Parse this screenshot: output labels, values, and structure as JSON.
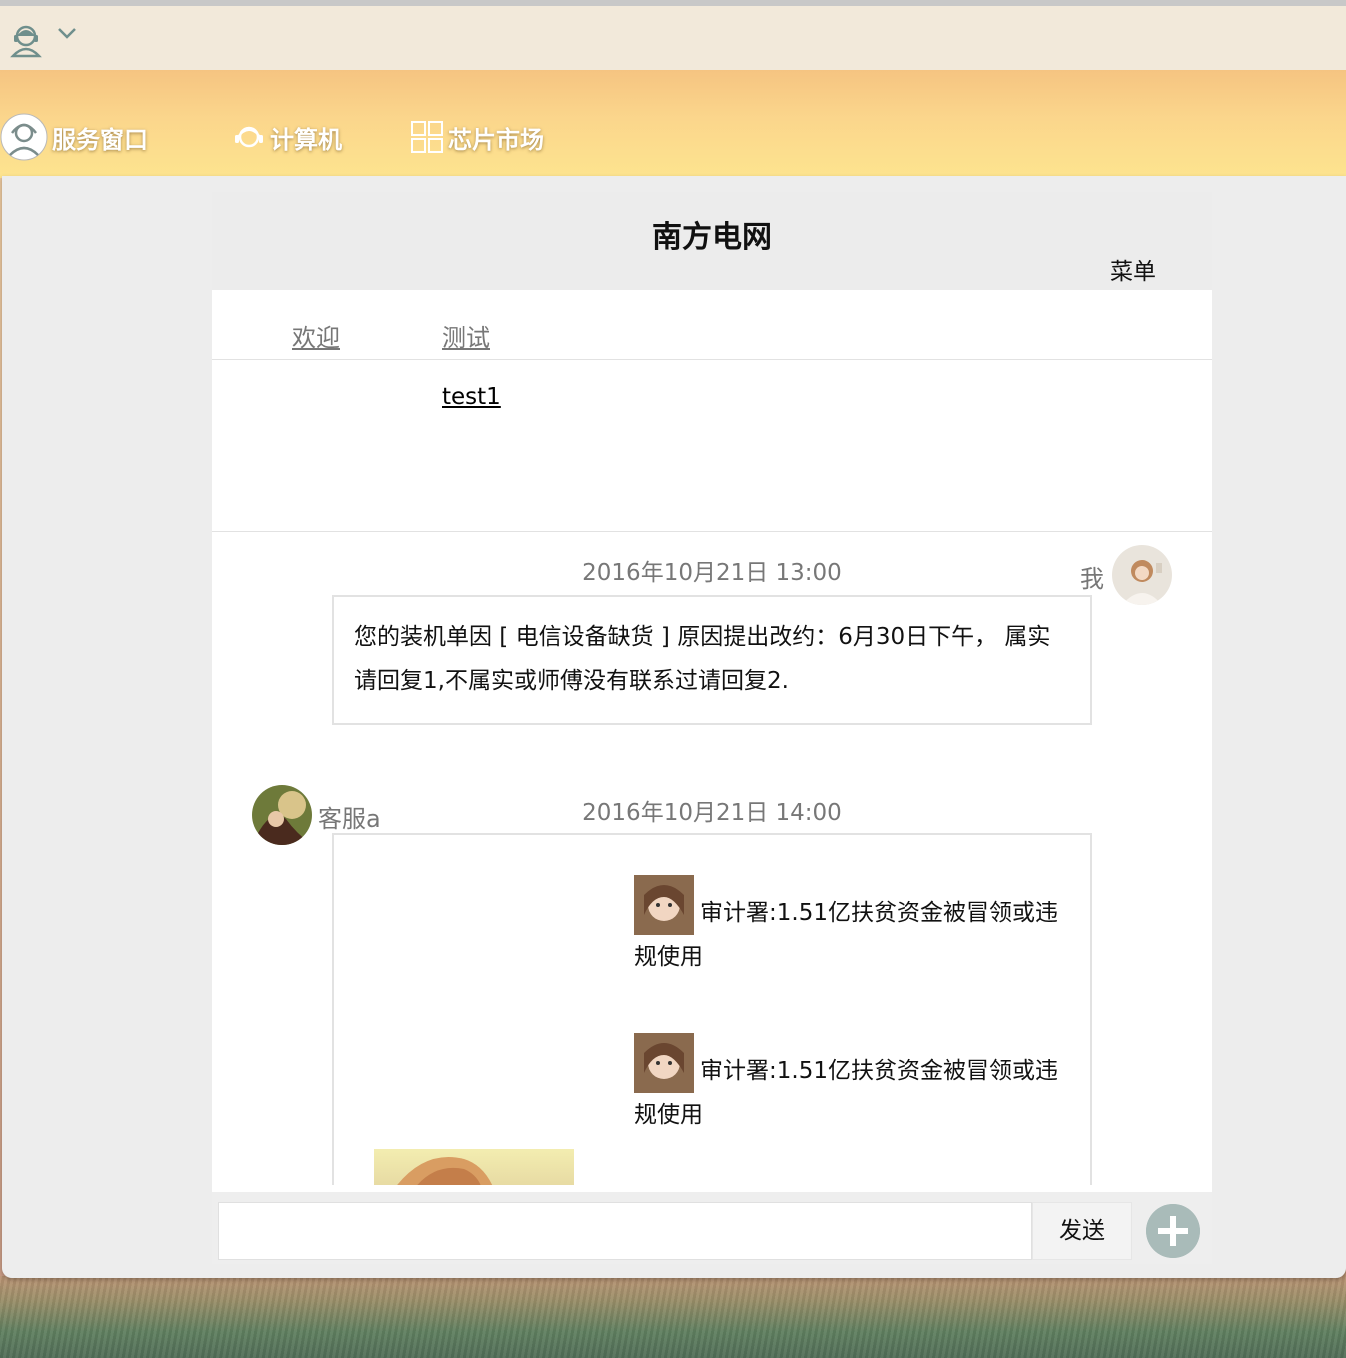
{
  "nav": {
    "items": [
      {
        "label": "服务窗口"
      },
      {
        "label": "计算机"
      },
      {
        "label": "芯片市场"
      }
    ]
  },
  "header": {
    "title": "南方电网",
    "menu_label": "菜单"
  },
  "tabs": [
    {
      "label": "欢迎"
    },
    {
      "label": "测试"
    }
  ],
  "submenu": {
    "item": "test1"
  },
  "chat": {
    "messages": [
      {
        "time": "2016年10月21日 13:00",
        "sender": "我",
        "text": "您的装机单因 [ 电信设备缺货 ] 原因提出改约：6月30日下午， 属实请回复1,不属实或师傅没有联系过请回复2."
      },
      {
        "time": "2016年10月21日 14:00",
        "sender": "客服a",
        "news": [
          {
            "title": "审计署:1.51亿扶贫资金被冒领或违规使用"
          },
          {
            "title": "审计署:1.51亿扶贫资金被冒领或违规使用"
          }
        ]
      }
    ]
  },
  "input": {
    "placeholder": "",
    "send_label": "发送"
  },
  "colors": {
    "nav_gradient_top": "#f5c481",
    "nav_gradient_bottom": "#fde48f",
    "panel_bg": "#ededed",
    "plus_button": "#a9bbb9"
  },
  "icons": {
    "titlebar": "customer-service-agent-icon",
    "dropdown": "chevron-down-icon",
    "nav_service": "headset-agent-icon",
    "nav_computer": "headset-icon",
    "nav_market": "grid-icon",
    "add": "plus-circle-icon"
  }
}
